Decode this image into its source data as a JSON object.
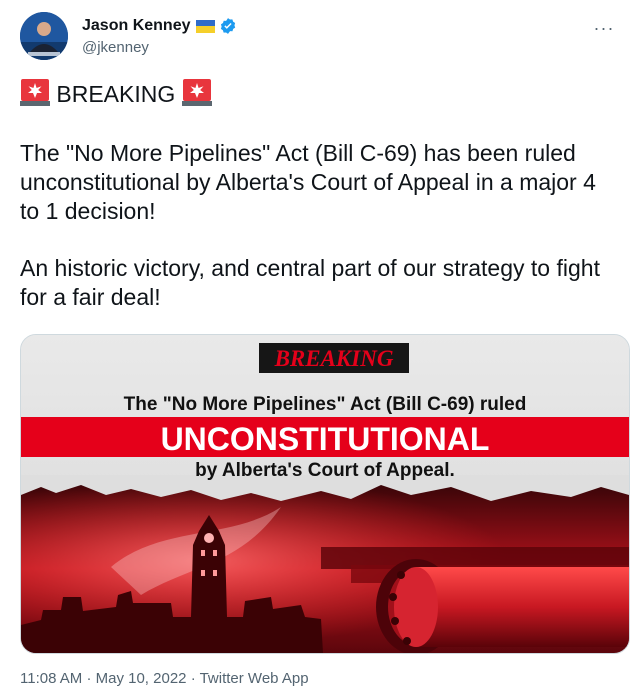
{
  "user": {
    "name": "Jason Kenney",
    "handle": "@jkenney",
    "flag_icon": "ukraine-flag-icon",
    "verified_icon": "verified-badge-icon"
  },
  "tweet": {
    "breaking_label": "BREAKING",
    "siren_icon": "rotating-light-icon",
    "paragraph1": "The \"No More Pipelines\" Act (Bill C-69) has been ruled unconstitutional by Alberta's Court of Appeal in a major 4 to 1 decision!",
    "paragraph2": "An historic victory, and central part of our strategy to fight for a fair deal!"
  },
  "media": {
    "banner": "BREAKING",
    "line1": "The \"No More Pipelines\" Act (Bill C-69) ruled",
    "headline": "UNCONSTITUTIONAL",
    "line2": "by Alberta's Court of Appeal."
  },
  "meta": {
    "time": "11:08 AM",
    "date": "May 10, 2022",
    "source": "Twitter Web App",
    "separator": "·"
  },
  "colors": {
    "verified_blue": "#1d9bf0",
    "accent_red": "#e5001a",
    "muted_text": "#536471"
  }
}
